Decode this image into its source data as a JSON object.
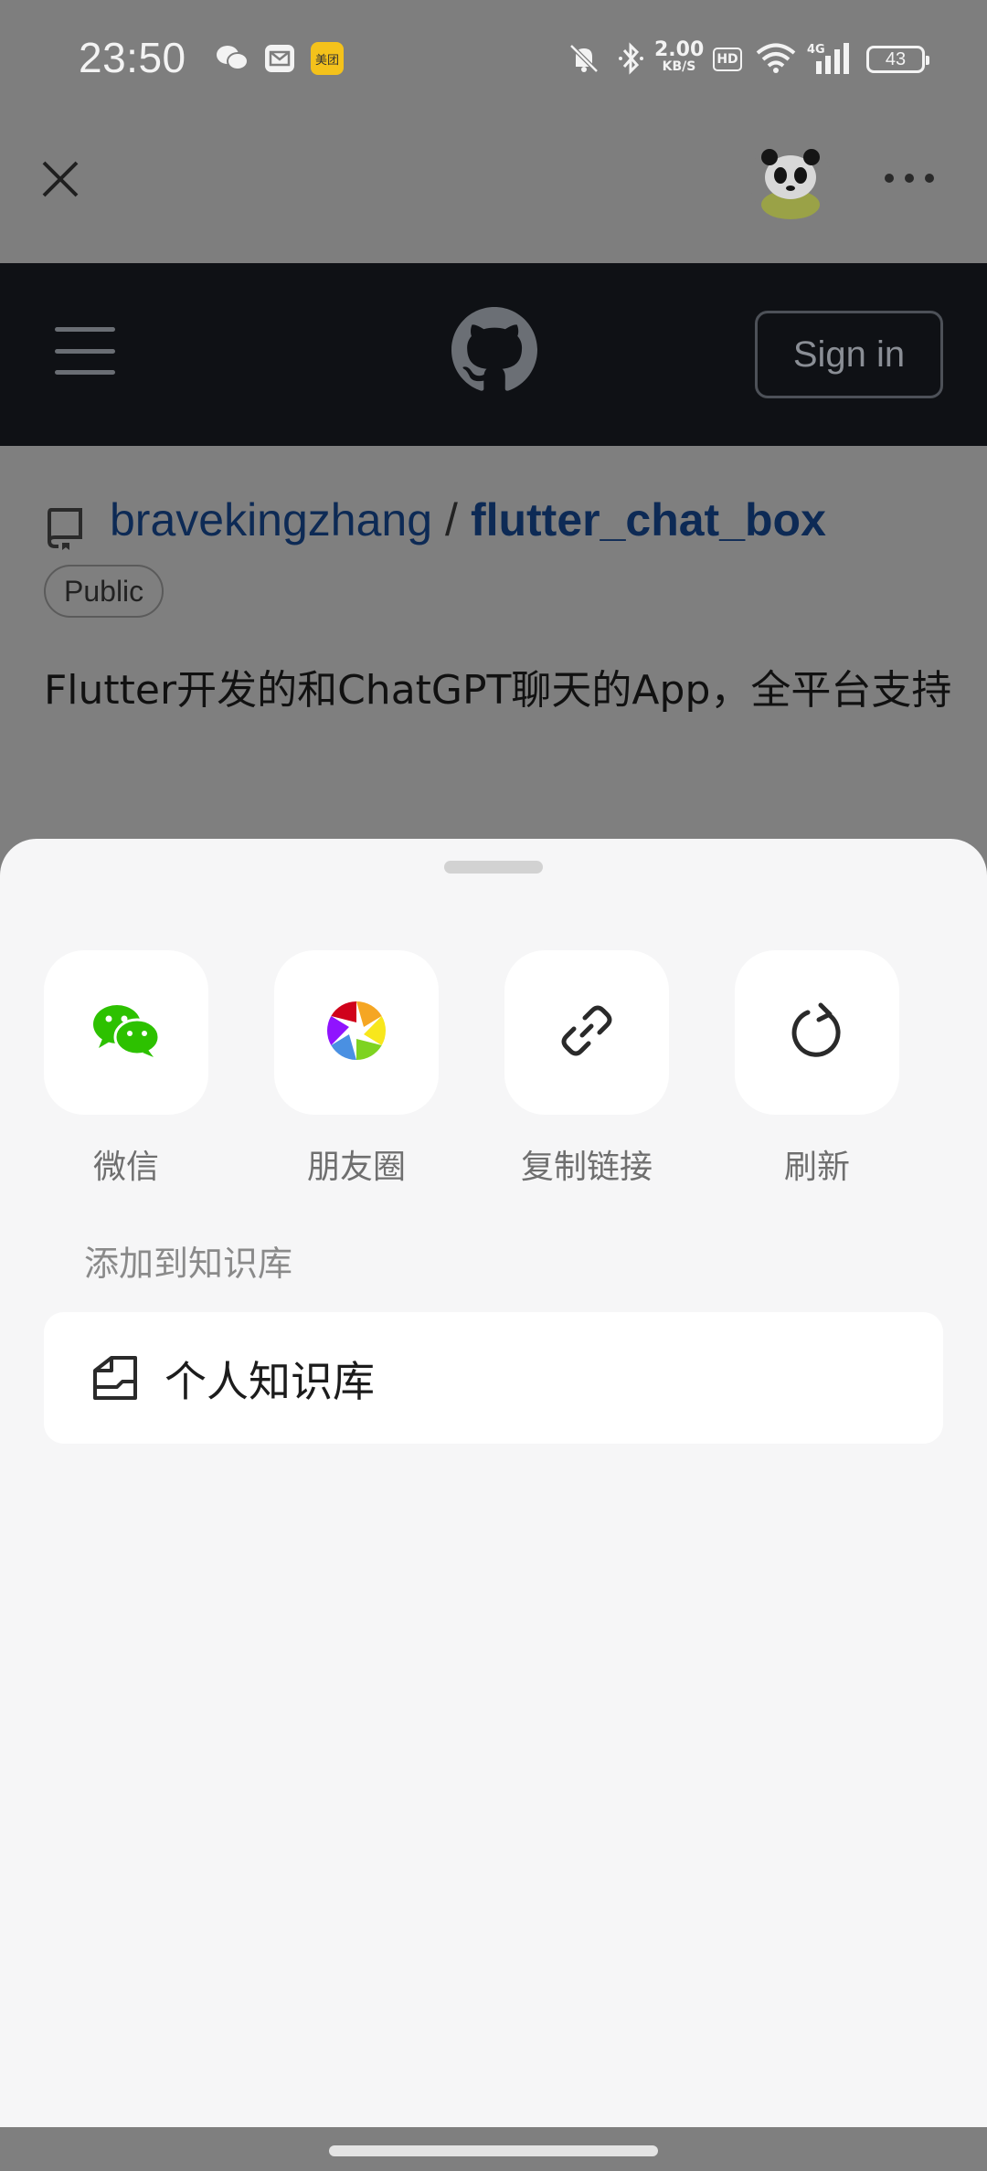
{
  "status_bar": {
    "time": "23:50",
    "notification_icons": [
      "wechat-icon",
      "mail-icon",
      "meituan-icon"
    ],
    "meituan_label": "美团",
    "net_speed_value": "2.00",
    "net_speed_unit": "KB/S",
    "hd_label": "HD",
    "signal_label": "4G",
    "battery": "43"
  },
  "app_bar": {
    "close_icon": "close-icon",
    "more_icon": "more-icon"
  },
  "github_header": {
    "signin_label": "Sign in"
  },
  "repo": {
    "owner": "bravekingzhang",
    "separator": "/",
    "name": "flutter_chat_box",
    "visibility": "Public",
    "description": "Flutter开发的和ChatGPT聊天的App，全平台支持"
  },
  "share_sheet": {
    "items": [
      {
        "label": "微信",
        "icon": "wechat-icon",
        "color": "#2dc100"
      },
      {
        "label": "朋友圈",
        "icon": "moments-icon"
      },
      {
        "label": "复制链接",
        "icon": "link-icon"
      },
      {
        "label": "刷新",
        "icon": "refresh-icon"
      }
    ],
    "kb_section_title": "添加到知识库",
    "kb_item_label": "个人知识库"
  }
}
